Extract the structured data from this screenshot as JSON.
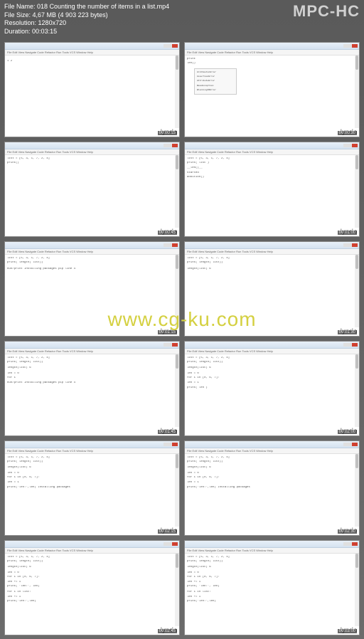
{
  "app_name": "MPC-HC",
  "file_info": {
    "name_label": "File Name:",
    "name_value": "018 Counting the number of items in a list.mp4",
    "size_label": "File Size:",
    "size_value": "4,67 MB (4 903 223 bytes)",
    "resolution_label": "Resolution:",
    "resolution_value": "1280x720",
    "duration_label": "Duration:",
    "duration_value": "00:03:15"
  },
  "site_watermark": "www.cg-ku.com",
  "thumbs": [
    {
      "timestamp": "00:00:15",
      "watermark": "lynda",
      "toolbar": "File Edit View Navigate Code Refactor Run Tools VCS Window Help",
      "content": [
        "",
        "",
        "",
        "                    1 2"
      ]
    },
    {
      "timestamp": "00:00:30",
      "watermark": "lynda",
      "toolbar": "File Edit View Navigate Code Refactor Run Tools VCS Window Help",
      "content": [
        "  print",
        "  len()",
        "  "
      ],
      "has_dropdown": true
    },
    {
      "timestamp": "00:00:45",
      "watermark": "lynda",
      "toolbar": "File Edit View Navigate Code Refactor Run Tools VCS Window Help",
      "content": [
        "list = [5, 3, 1, 7, 2, 4]",
        "print()"
      ]
    },
    {
      "timestamp": "00:01:00",
      "watermark": "lynda",
      "toolbar": "File Edit View Navigate Code Refactor Run Tools VCS Window Help",
      "content": [
        "list = [5, 3, 1, 7, 2, 4]",
        "print( list )",
        "  __len()__",
        "  started",
        "  addition()"
      ]
    },
    {
      "timestamp": "00:01:15",
      "watermark": "lynda",
      "toolbar": "File Edit View Navigate Code Refactor Run Tools VCS Window Help",
      "content": [
        "list = [5, 3, 1, 7, 2, 4]",
        "print( length( list))",
        "",
        "",
        "Run/print  Installing packages  pip  line   4  "
      ]
    },
    {
      "timestamp": "00:01:30",
      "watermark": "lynda",
      "toolbar": "File Edit View Navigate Code Refactor Run Tools VCS Window Help",
      "content": [
        "list = [5, 3, 1, 7, 2, 4]",
        "print( length( list))",
        "",
        "",
        "length(list)  6"
      ]
    },
    {
      "timestamp": "00:01:45",
      "watermark": "lynda",
      "toolbar": "File Edit View Navigate Code Refactor Run Tools VCS Window Help",
      "content": [
        "list = [5, 3, 1, 7, 2, 4]",
        "print( length( list))",
        "",
        "length(list)  6",
        "",
        "len = 0",
        "for i",
        "Run/print  Installing packages  pip  line   4  "
      ]
    },
    {
      "timestamp": "00:02:00",
      "watermark": "lynda",
      "toolbar": "File Edit View Navigate Code Refactor Run Tools VCS Window Help",
      "content": [
        "list = [5, 3, 1, 7, 2, 4]",
        "print( length( list))",
        "",
        "length(list)  6",
        "",
        "len = 0",
        "for i in [0, 6, 7]:",
        "  len = 1",
        "",
        "print( len )"
      ]
    },
    {
      "timestamp": "00:02:15",
      "watermark": "lynda",
      "toolbar": "File Edit View Navigate Code Refactor Run Tools VCS Window Help",
      "content": [
        "list = [5, 3, 1, 7, 2, 4]",
        "print( length( list))",
        "",
        "length(list)  6",
        "",
        "len = 0",
        "for i in [0, 6, 7]:",
        "  len = 1",
        "",
        "print('len:',len)  Installing packages"
      ]
    },
    {
      "timestamp": "00:02:30",
      "watermark": "lynda",
      "toolbar": "File Edit View Navigate Code Refactor Run Tools VCS Window Help",
      "content": [
        "list = [5, 3, 1, 7, 2, 4]",
        "print( length( list))",
        "",
        "length(list)  6",
        "",
        "len = 0",
        "for i in [0, 6, 7]:",
        "  len = 1",
        "",
        "print('len:',len)  Installing packages"
      ]
    },
    {
      "timestamp": "00:02:45",
      "watermark": "lynda",
      "toolbar": "File Edit View Navigate Code Refactor Run Tools VCS Window Help",
      "content": [
        "list = [5, 3, 1, 7, 2, 4]",
        "print( length( list))",
        "",
        "length(list)  6",
        "",
        "len = 0",
        "for i in [0, 6, 7]:",
        "  len += 1",
        "print( 'len:', len)",
        "",
        "for i in list:",
        "  len += 1",
        "print('len:',len)"
      ]
    },
    {
      "timestamp": "00:03:00",
      "watermark": "lynda",
      "toolbar": "File Edit View Navigate Code Refactor Run Tools VCS Window Help",
      "content": [
        "list = [5, 3, 1, 7, 2, 4]",
        "print( length( list))",
        "",
        "length(list)  6",
        "",
        "len = 0",
        "for i in [0, 6, 7]:",
        "  len += 1",
        "print( 'len:', len)",
        "",
        "for i in list:",
        "  len += 1",
        "print('len:',len)"
      ]
    }
  ]
}
